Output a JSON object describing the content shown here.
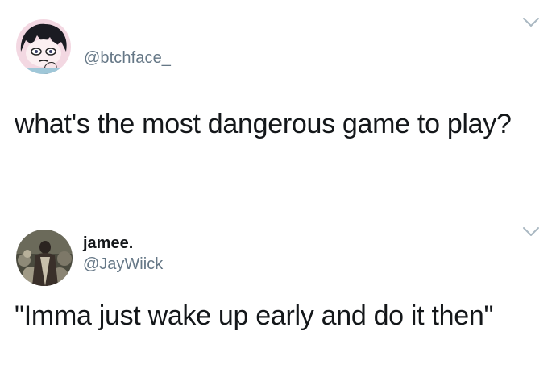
{
  "tweets": [
    {
      "handle": "@btchface_",
      "text": "what's the most dangerous game to play?"
    },
    {
      "display_name": "jamee.",
      "handle": "@JayWiick",
      "text": "\"Imma just wake up early and do it then\""
    }
  ],
  "icons": {
    "menu": "chevron-down-icon"
  }
}
